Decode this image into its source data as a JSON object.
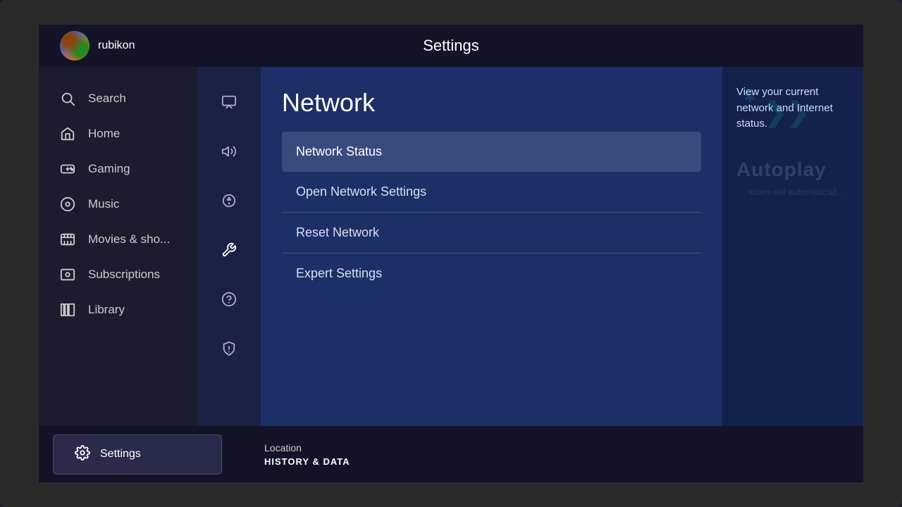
{
  "app": {
    "title": "Settings"
  },
  "user": {
    "name": "rubikon"
  },
  "left_nav": {
    "items": [
      {
        "id": "search",
        "label": "Search",
        "icon": "search"
      },
      {
        "id": "home",
        "label": "Home",
        "icon": "home"
      },
      {
        "id": "gaming",
        "label": "Gaming",
        "icon": "gaming"
      },
      {
        "id": "music",
        "label": "Music",
        "icon": "music"
      },
      {
        "id": "movies",
        "label": "Movies & sho...",
        "icon": "movies"
      },
      {
        "id": "subscriptions",
        "label": "Subscriptions",
        "icon": "subscriptions"
      },
      {
        "id": "library",
        "label": "Library",
        "icon": "library"
      }
    ]
  },
  "settings_icons": [
    {
      "id": "display",
      "icon": "image"
    },
    {
      "id": "audio",
      "icon": "volume"
    },
    {
      "id": "remote",
      "icon": "remote"
    },
    {
      "id": "network",
      "icon": "wrench",
      "active": true
    },
    {
      "id": "help",
      "icon": "help"
    },
    {
      "id": "privacy",
      "icon": "shield"
    }
  ],
  "network": {
    "title": "Network",
    "menu_items": [
      {
        "id": "status",
        "label": "Network Status",
        "selected": true
      },
      {
        "id": "open",
        "label": "Open Network Settings",
        "selected": false
      },
      {
        "id": "reset",
        "label": "Reset Network",
        "selected": false
      },
      {
        "id": "expert",
        "label": "Expert Settings",
        "selected": false
      }
    ]
  },
  "info": {
    "description": "View your current network and Internet status."
  },
  "bottom": {
    "settings_label": "Settings",
    "location_label": "Location",
    "history_label": "HISTORY & DATA"
  },
  "right_side": {
    "autoplay_label": "Autoplay",
    "autoplay_sub": "video will automaticall..."
  },
  "colors": {
    "accent_teal": "#00ccff",
    "accent_green": "#00ddaa",
    "selected_bg": "rgba(220,230,255,0.15)"
  }
}
